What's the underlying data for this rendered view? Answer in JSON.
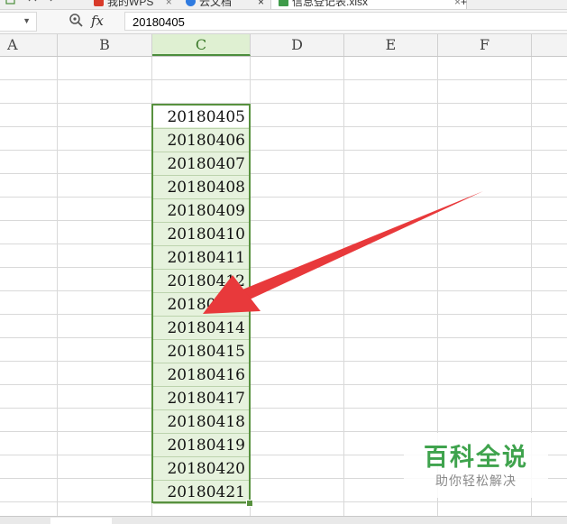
{
  "tabs": [
    {
      "label": "我的WPS",
      "close": "×",
      "icon": "wps-icon"
    },
    {
      "label": "云文档",
      "icon": "cloud-icon"
    },
    {
      "label": "信息登记表.xlsx",
      "close": "×",
      "icon": "sheet-icon",
      "active": true
    }
  ],
  "toolbar": {
    "new_tab": "+",
    "close_symbol": "×"
  },
  "formula_bar": {
    "name_box": "",
    "fx": "fx",
    "value": "20180405"
  },
  "columns": [
    "A",
    "B",
    "C",
    "D",
    "E",
    "F"
  ],
  "selected_column": "C",
  "cells": [
    "20180405",
    "20180406",
    "20180407",
    "20180408",
    "20180409",
    "20180410",
    "20180411",
    "20180412",
    "20180413",
    "20180414",
    "20180415",
    "20180416",
    "20180417",
    "20180418",
    "20180419",
    "20180420",
    "20180421"
  ],
  "annotation": {
    "color": "#e8393b"
  },
  "colors": {
    "selection": "#58913f",
    "selection_fill": "#e6f2dd",
    "header_selected": "#dff0d2"
  },
  "watermark": {
    "title": "百科全说",
    "subtitle": "助你轻松解决"
  }
}
